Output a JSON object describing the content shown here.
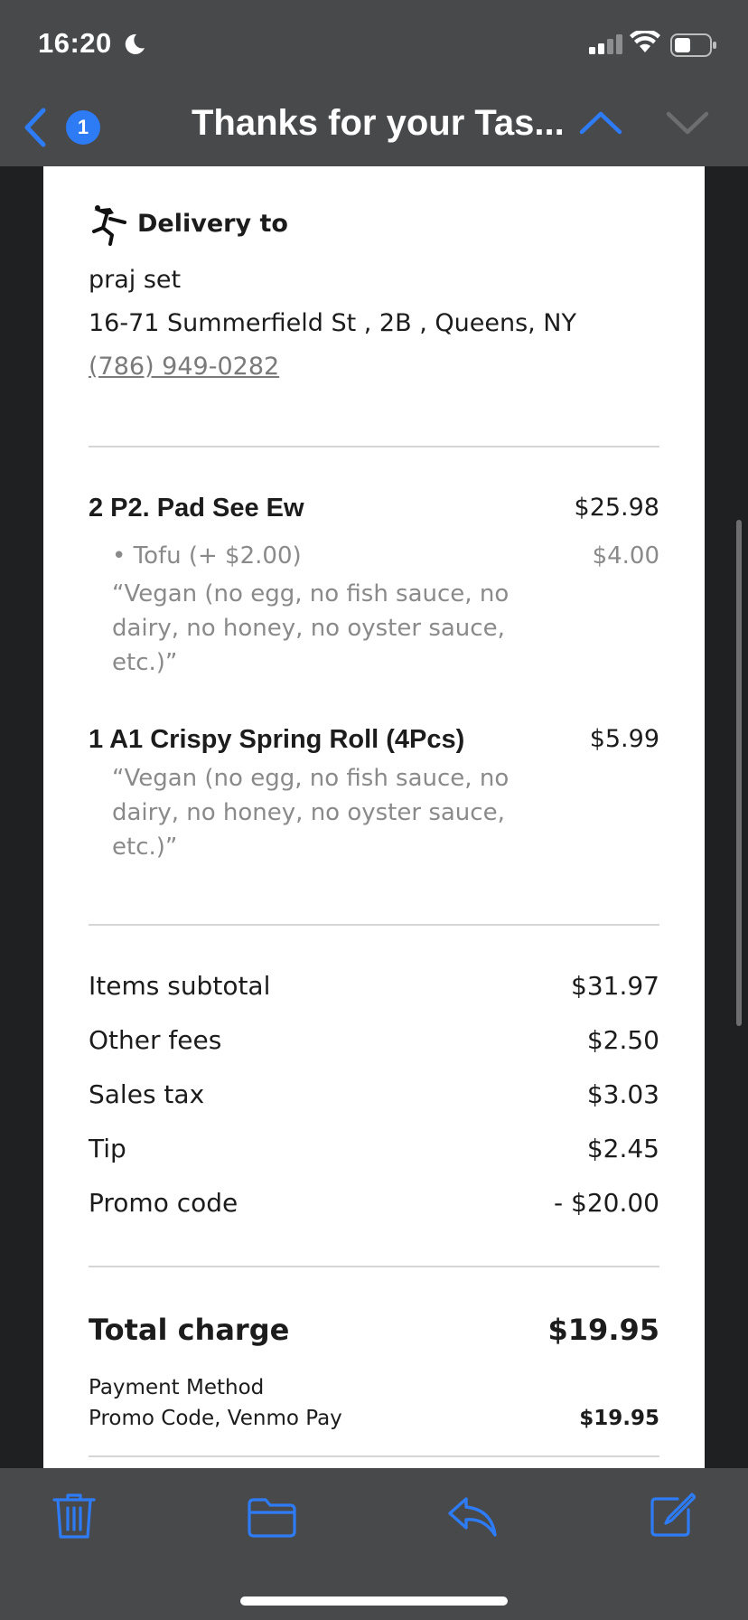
{
  "status_bar": {
    "time": "16:20",
    "icons": [
      "moon-icon",
      "signal-icon",
      "wifi-icon",
      "battery-icon"
    ]
  },
  "nav": {
    "back_icon": "chevron-left-icon",
    "unread_count": "1",
    "title": "Thanks for your Tas...",
    "prev_icon": "chevron-up-icon",
    "next_icon": "chevron-down-icon"
  },
  "delivery": {
    "icon": "delivery-rider-icon",
    "heading": "Delivery to",
    "name": "praj set",
    "address": "16-71 Summerfield St , 2B , Queens, NY",
    "phone": "(786) 949-0282"
  },
  "items": [
    {
      "name": "2 P2. Pad See Ew",
      "price": "$25.98",
      "modifier": "• Tofu (+ $2.00)",
      "modifier_price": "$4.00",
      "note_lines": [
        "“Vegan (no egg, no fish sauce, no",
        "dairy, no honey, no oyster sauce,",
        "etc.)”"
      ]
    },
    {
      "name": "1 A1 Crispy Spring Roll (4Pcs)",
      "price": "$5.99",
      "note_lines": [
        "“Vegan (no egg, no fish sauce, no",
        "dairy, no honey, no oyster sauce,",
        "etc.)”"
      ]
    }
  ],
  "summary": [
    {
      "label": "Items subtotal",
      "value": "$31.97"
    },
    {
      "label": "Other fees",
      "value": "$2.50"
    },
    {
      "label": "Sales tax",
      "value": "$3.03"
    },
    {
      "label": "Tip",
      "value": "$2.45"
    },
    {
      "label": "Promo code",
      "value": "- $20.00"
    }
  ],
  "total": {
    "label": "Total charge",
    "value": "$19.95"
  },
  "payment": {
    "label": "Payment Method",
    "method": "Promo Code, Venmo Pay",
    "amount": "$19.95"
  },
  "toolbar": {
    "icons": [
      "trash-icon",
      "folder-icon",
      "reply-icon",
      "compose-icon"
    ]
  },
  "colors": {
    "accent": "#2e7bf6",
    "bar_background": "#48494b",
    "paper": "#ffffff",
    "muted_text": "#8a8a8a"
  }
}
